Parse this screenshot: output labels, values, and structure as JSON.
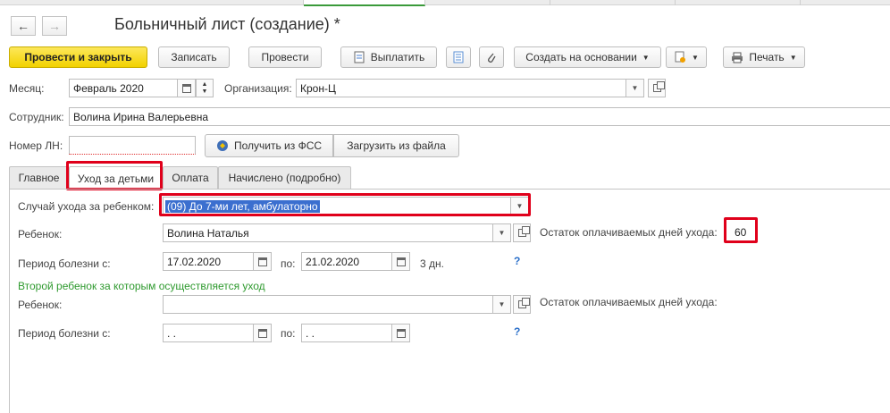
{
  "window": {
    "title": "Больничный лист (создание) *"
  },
  "toolbar": {
    "post_close": "Провести и закрыть",
    "save": "Записать",
    "post": "Провести",
    "pay": "Выплатить",
    "create_based": "Создать на основании",
    "print": "Печать"
  },
  "header": {
    "month_label": "Месяц:",
    "month_value": "Февраль 2020",
    "org_label": "Организация:",
    "org_value": "Крон-Ц",
    "employee_label": "Сотрудник:",
    "employee_value": "Волина Ирина Валерьевна",
    "ln_label": "Номер ЛН:",
    "ln_value": "",
    "get_fss": "Получить из ФСС",
    "load_file": "Загрузить из файла"
  },
  "tabs": [
    {
      "label": "Главное"
    },
    {
      "label": "Уход за детьми"
    },
    {
      "label": "Оплата"
    },
    {
      "label": "Начислено (подробно)"
    }
  ],
  "care": {
    "case_label": "Случай ухода за ребенком:",
    "case_value": "(09) До 7-ми лет, амбулаторно",
    "child_label": "Ребенок:",
    "child_value": "Волина Наталья",
    "remaining_label": "Остаток оплачиваемых дней ухода:",
    "remaining_value": "60",
    "period_label": "Период болезни с:",
    "period_from": "17.02.2020",
    "period_to_label": "по:",
    "period_to": "21.02.2020",
    "days": "3 дн.",
    "help": "?",
    "second_child_header": "Второй ребенок за которым осуществляется уход",
    "child2_label": "Ребенок:",
    "child2_value": "",
    "remaining2_label": "Остаток оплачиваемых дней ухода:",
    "period2_label": "Период болезни с:",
    "period2_from": " .  .",
    "period2_to_label": "по:",
    "period2_to": " .  .",
    "help2": "?"
  }
}
